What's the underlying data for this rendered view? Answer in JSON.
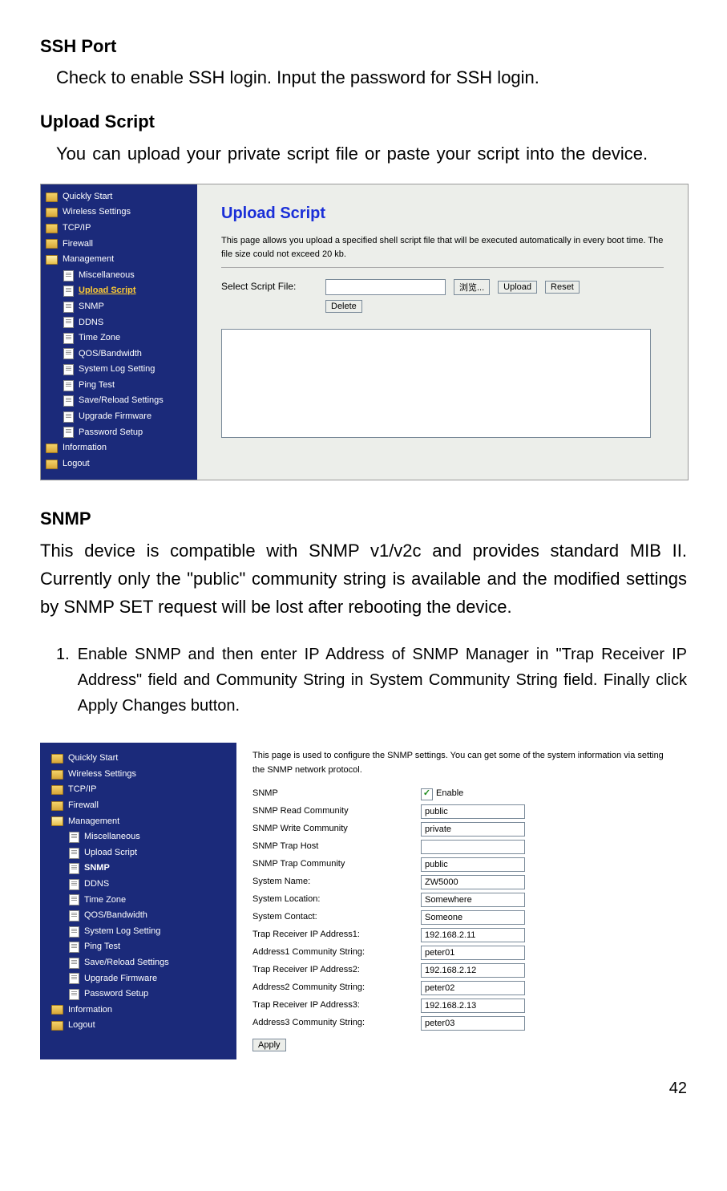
{
  "doc": {
    "ssh_port_title": "SSH Port",
    "ssh_port_body": "Check to enable SSH login. Input the password for SSH login.",
    "upload_script_title": "Upload Script",
    "upload_script_body": "You can upload your private script file or paste your script into the device.",
    "snmp_title": "SNMP",
    "snmp_body": "This device is compatible with SNMP v1/v2c and provides standard MIB II. Currently only the \"public\" community string is available and the modified settings by SNMP SET request will be lost after rebooting the device.",
    "step1_num": "1.",
    "step1_body": "Enable SNMP and then enter IP Address of SNMP Manager in \"Trap Receiver IP Address\" field and Community String in System Community String field. Finally click Apply Changes button.",
    "page_number": "42"
  },
  "shot1": {
    "sidebar": {
      "quickly_start": "Quickly Start",
      "wireless": "Wireless Settings",
      "tcpip": "TCP/IP",
      "firewall": "Firewall",
      "management": "Management",
      "misc": "Miscellaneous",
      "upload_script": "Upload Script",
      "snmp": "SNMP",
      "ddns": "DDNS",
      "timezone": "Time Zone",
      "qos": "QOS/Bandwidth",
      "syslog": "System Log Setting",
      "ping": "Ping Test",
      "save": "Save/Reload Settings",
      "upgrade": "Upgrade Firmware",
      "password": "Password Setup",
      "information": "Information",
      "logout": "Logout"
    },
    "content": {
      "title": "Upload Script",
      "desc": "This page allows you upload a specified shell script file that will be executed automatically in every boot time. The file size could not exceed 20 kb.",
      "select_label": "Select Script File:",
      "browse_btn": "浏览...",
      "upload_btn": "Upload",
      "reset_btn": "Reset",
      "delete_btn": "Delete"
    }
  },
  "shot2": {
    "sidebar": {
      "quickly_start": "Quickly Start",
      "wireless": "Wireless Settings",
      "tcpip": "TCP/IP",
      "firewall": "Firewall",
      "management": "Management",
      "misc": "Miscellaneous",
      "upload_script": "Upload Script",
      "snmp": "SNMP",
      "ddns": "DDNS",
      "timezone": "Time Zone",
      "qos": "QOS/Bandwidth",
      "syslog": "System Log Setting",
      "ping": "Ping Test",
      "save": "Save/Reload Settings",
      "upgrade": "Upgrade Firmware",
      "password": "Password Setup",
      "information": "Information",
      "logout": "Logout"
    },
    "content": {
      "desc": "This page is used to configure the SNMP settings. You can get some of the system information via setting the SNMP network protocol.",
      "rows": {
        "snmp": "SNMP",
        "enable": "Enable",
        "read_comm_l": "SNMP Read Community",
        "read_comm_v": "public",
        "write_comm_l": "SNMP Write Community",
        "write_comm_v": "private",
        "trap_host_l": "SNMP Trap Host",
        "trap_host_v": "",
        "trap_comm_l": "SNMP Trap Community",
        "trap_comm_v": "public",
        "sys_name_l": "System Name:",
        "sys_name_v": "ZW5000",
        "sys_loc_l": "System Location:",
        "sys_loc_v": "Somewhere",
        "sys_contact_l": "System Contact:",
        "sys_contact_v": "Someone",
        "trap1_l": "Trap Receiver IP Address1:",
        "trap1_v": "192.168.2.11",
        "comm1_l": "Address1 Community String:",
        "comm1_v": "peter01",
        "trap2_l": "Trap Receiver IP Address2:",
        "trap2_v": "192.168.2.12",
        "comm2_l": "Address2 Community String:",
        "comm2_v": "peter02",
        "trap3_l": "Trap Receiver IP Address3:",
        "trap3_v": "192.168.2.13",
        "comm3_l": "Address3 Community String:",
        "comm3_v": "peter03"
      },
      "apply_btn": "Apply"
    }
  }
}
